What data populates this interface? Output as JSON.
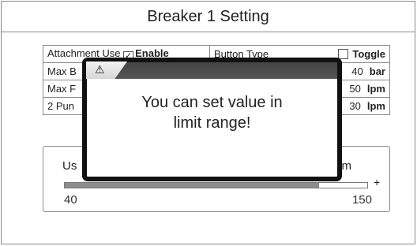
{
  "title": "Breaker 1 Setting",
  "rows": [
    {
      "left_label": "Attachment Use",
      "left_value": "Enable",
      "left_checked": "✓",
      "right_label": "Button Type",
      "right_value": "Toggle"
    },
    {
      "left_label": "Max B",
      "right_value": "40",
      "right_unit": "bar"
    },
    {
      "left_label": "Max F",
      "right_value": "50",
      "right_unit": "lpm"
    },
    {
      "left_label": "2 Pun",
      "right_value": "30",
      "right_unit": "lpm"
    }
  ],
  "use_panel": {
    "label": "Us",
    "unit": "m",
    "minus": "-",
    "plus": "+",
    "min": "40",
    "max": "150",
    "fill_fraction": 0.84
  },
  "popup": {
    "warning_icon": "⚠",
    "message_line1": "You can set value in",
    "message_line2": "limit range!"
  }
}
